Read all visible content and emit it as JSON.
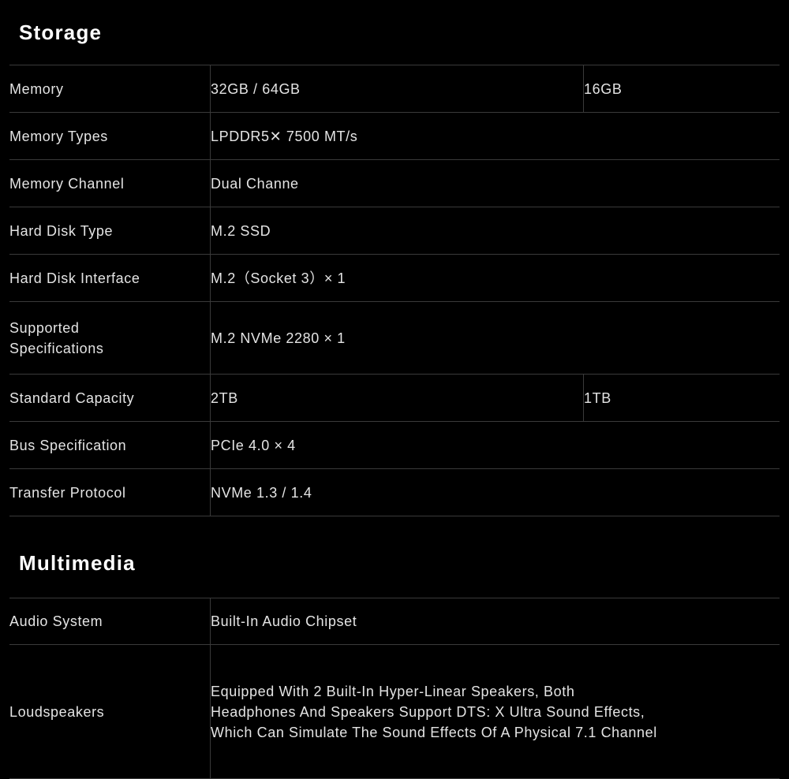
{
  "sections": [
    {
      "title": "Storage",
      "rows": [
        {
          "label": "Memory",
          "value": "32GB / 64GB",
          "value2": "16GB"
        },
        {
          "label": "Memory Types",
          "value": "LPDDR5✕ 7500 MT/s",
          "value2": null
        },
        {
          "label": "Memory Channel",
          "value": "Dual Channe",
          "value2": null
        },
        {
          "label": "Hard Disk Type",
          "value": "M.2 SSD",
          "value2": null
        },
        {
          "label": "Hard Disk Interface",
          "value": "M.2（Socket 3）× 1",
          "value2": null
        },
        {
          "label": "Supported\nSpecifications",
          "value": "M.2 NVMe 2280 × 1",
          "value2": null
        },
        {
          "label": "Standard Capacity",
          "value": "2TB",
          "value2": "1TB"
        },
        {
          "label": "Bus Specification",
          "value": "PCIe 4.0 × 4",
          "value2": null
        },
        {
          "label": "Transfer Protocol",
          "value": "NVMe 1.3 / 1.4",
          "value2": null
        }
      ]
    },
    {
      "title": "Multimedia",
      "rows": [
        {
          "label": "Audio System",
          "value": "Built-In Audio Chipset",
          "value2": null
        },
        {
          "label": "Loudspeakers",
          "value": "Equipped With 2 Built-In Hyper-Linear Speakers, Both\nHeadphones And Speakers Support DTS: X Ultra Sound Effects,\nWhich Can Simulate The Sound Effects Of A Physical 7.1 Channel",
          "value2": null
        }
      ]
    }
  ],
  "colors": {
    "background": "#000000",
    "text": "#e4e4e4",
    "title_text": "#ffffff",
    "rule": "#3a3a3a"
  }
}
